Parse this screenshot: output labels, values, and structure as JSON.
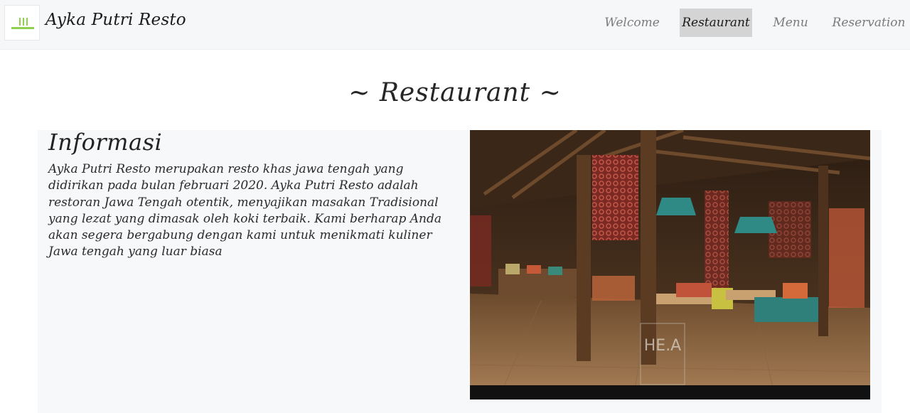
{
  "header": {
    "brand": "Ayka Putri Resto",
    "logo_icon": "restaurant-logo-icon",
    "nav": [
      {
        "label": "Welcome",
        "active": false
      },
      {
        "label": "Restaurant",
        "active": true
      },
      {
        "label": "Menu",
        "active": false
      },
      {
        "label": "Reservation",
        "active": false
      }
    ]
  },
  "main": {
    "title": "~ Restaurant ~",
    "info": {
      "heading": "Informasi",
      "text": "Ayka Putri Resto merupakan resto khas jawa tengah yang didirikan pada bulan februari 2020. Ayka Putri Resto adalah restoran Jawa Tengah otentik, menyajikan masakan Tradisional yang lezat yang dimasak oleh koki terbaik. Kami berharap Anda akan segera bergabung dengan kami untuk menikmati kuliner Jawa tengah yang luar biasa"
    },
    "photo_watermark": "HE.A"
  },
  "colors": {
    "accent": "#8fd14f",
    "nav_active_bg": "#d4d4d4",
    "navbar_bg": "#f6f7f9",
    "content_bg": "#f7f8fa"
  }
}
